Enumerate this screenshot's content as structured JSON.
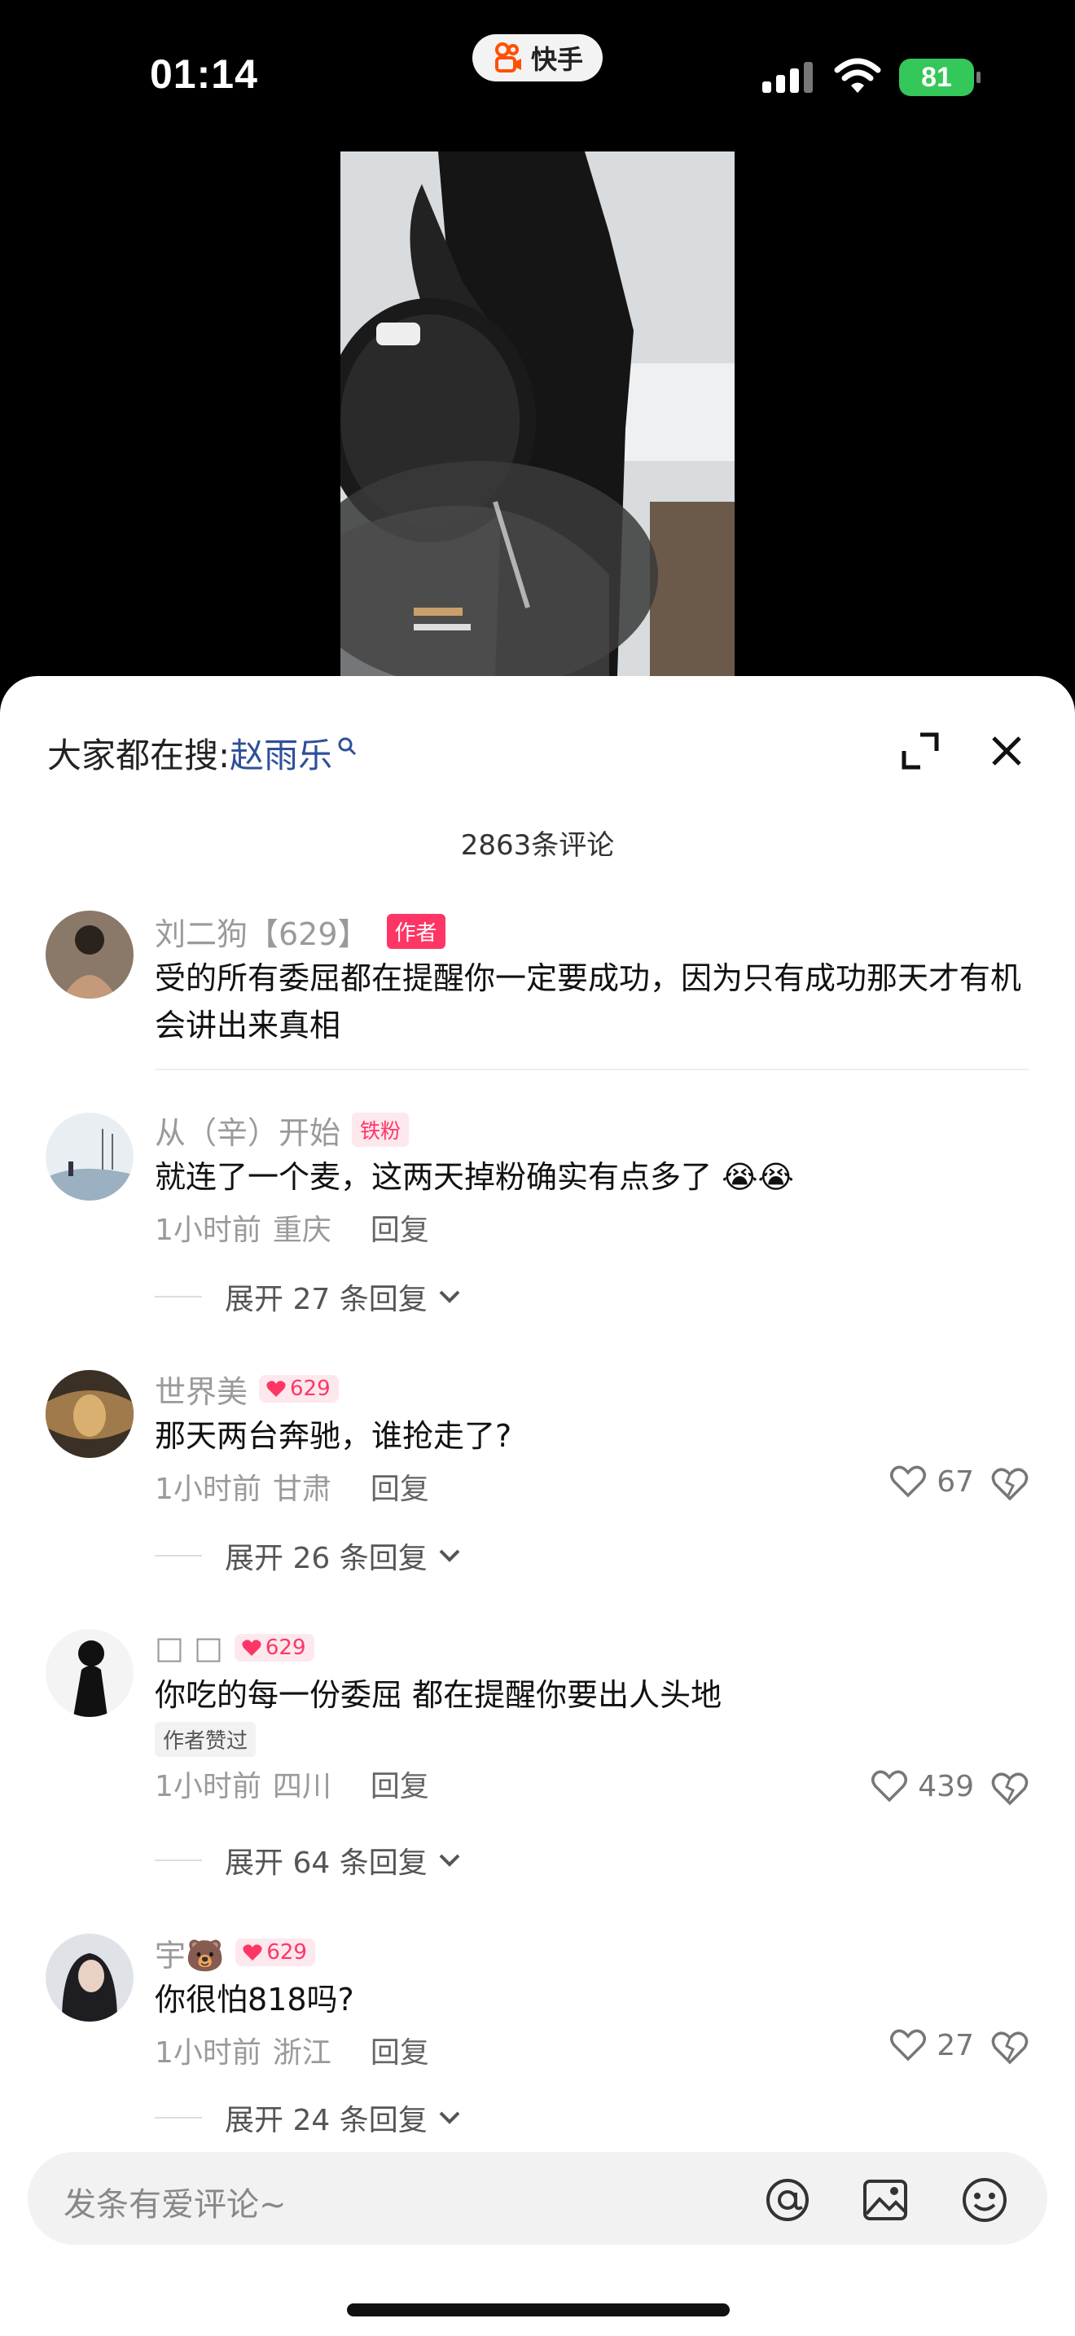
{
  "status_bar": {
    "time": "01:14",
    "app_name": "快手",
    "battery": "81"
  },
  "sheet": {
    "search_prefix": "大家都在搜:",
    "search_term": "赵雨乐",
    "comment_count": "2863条评论"
  },
  "comments": [
    {
      "user": "刘二狗【629】",
      "tag": "作者",
      "text_line1": "受的所有委屈都在提醒你一定要成功，因为只有成功那天才有机",
      "text_line2": "会讲出来真相"
    },
    {
      "user": "从（辛）开始",
      "tag": "铁粉",
      "text": "就连了一个麦，这两天掉粉确实有点多了",
      "time": "1小时前",
      "location": "重庆",
      "reply": "回复",
      "expand": "展开 27 条回复"
    },
    {
      "user": "世界美",
      "level": "629",
      "text": "那天两台奔驰，谁抢走了?",
      "time": "1小时前",
      "location": "甘肃",
      "reply": "回复",
      "likes": "67",
      "expand": "展开 26 条回复"
    },
    {
      "user": "□ □",
      "level": "629",
      "text": "你吃的每一份委屈 都在提醒你要出人头地",
      "badge": "作者赞过",
      "time": "1小时前",
      "location": "四川",
      "reply": "回复",
      "likes": "439",
      "expand": "展开 64 条回复"
    },
    {
      "user": "宇🐻",
      "level": "629",
      "text": "你很怕818吗?",
      "time": "1小时前",
      "location": "浙江",
      "reply": "回复",
      "likes": "27",
      "expand": "展开 24 条回复"
    }
  ],
  "input": {
    "placeholder": "发条有爱评论~"
  },
  "colors": {
    "accent": "#fe3666",
    "search_term": "#2f4f9a",
    "battery": "#34c759"
  }
}
